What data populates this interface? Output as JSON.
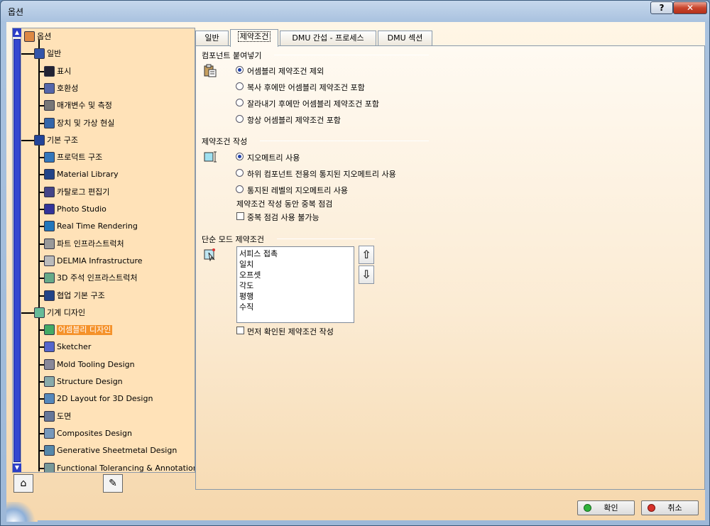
{
  "window": {
    "title": "옵션",
    "help": "?",
    "close": "✕"
  },
  "tree": {
    "items": [
      {
        "label": "옵션",
        "icon": "options-root-icon"
      },
      {
        "label": "일반",
        "icon": "general-icon"
      },
      {
        "label": "표시",
        "icon": "display-icon"
      },
      {
        "label": "호환성",
        "icon": "compatibility-icon"
      },
      {
        "label": "매개변수 및 측정",
        "icon": "parameters-icon"
      },
      {
        "label": "장치 및 가상 현실",
        "icon": "devices-icon"
      },
      {
        "label": "기본 구조",
        "icon": "infrastructure-icon"
      },
      {
        "label": "프로덕트 구조",
        "icon": "product-structure-icon"
      },
      {
        "label": "Material Library",
        "icon": "material-library-icon"
      },
      {
        "label": "카탈로그 편집기",
        "icon": "catalog-editor-icon"
      },
      {
        "label": "Photo Studio",
        "icon": "photo-studio-icon"
      },
      {
        "label": "Real Time Rendering",
        "icon": "rendering-icon"
      },
      {
        "label": "파트 인프라스트럭처",
        "icon": "part-infra-icon"
      },
      {
        "label": "DELMIA Infrastructure",
        "icon": "delmia-icon"
      },
      {
        "label": "3D 주석 인프라스트럭처",
        "icon": "annotation-infra-icon"
      },
      {
        "label": "협업 기본 구조",
        "icon": "collab-icon"
      },
      {
        "label": "기계 디자인",
        "icon": "mechanical-design-icon"
      },
      {
        "label": "어셈블리 디자인",
        "icon": "assembly-design-icon"
      },
      {
        "label": "Sketcher",
        "icon": "sketcher-icon"
      },
      {
        "label": "Mold Tooling Design",
        "icon": "mold-icon"
      },
      {
        "label": "Structure Design",
        "icon": "structure-icon"
      },
      {
        "label": "2D Layout for 3D Design",
        "icon": "layout-icon"
      },
      {
        "label": "도면",
        "icon": "drawing-icon"
      },
      {
        "label": "Composites Design",
        "icon": "composites-icon"
      },
      {
        "label": "Generative Sheetmetal Design",
        "icon": "sheetmetal-icon"
      },
      {
        "label": "Functional Tolerancing & Annotation",
        "icon": "tolerancing-icon"
      }
    ]
  },
  "tabs": [
    {
      "label": "일반"
    },
    {
      "label": "제약조건"
    },
    {
      "label": "DMU 간섭 - 프로세스"
    },
    {
      "label": "DMU 섹션"
    }
  ],
  "paste": {
    "title": "컴포넌트 붙여넣기",
    "options": [
      "어셈블리 제약조건 제외",
      "복사 후에만 어셈블리 제약조건 포함",
      "잘라내기 후에만 어셈블리 제약조건 포함",
      "항상 어셈블리 제약조건 포함"
    ],
    "selected": 0
  },
  "create": {
    "title": "제약조건 작성",
    "options": [
      "지오메트리 사용",
      "하위 컴포넌트 전용의 통지된 지오메트리 사용",
      "통지된 레벨의 지오메트리 사용"
    ],
    "selected": 0,
    "dup_label": "제약조건 작성 동안 중복 점검",
    "dup_checkbox": "중복 점검 사용 불가능"
  },
  "quick": {
    "title": "단순 모드 제약조건",
    "list": [
      "서피스 접촉",
      "일치",
      "오프셋",
      "각도",
      "평행",
      "수직"
    ],
    "up": "⇧",
    "down": "⇩",
    "checkbox": "먼저 확인된 제약조건 작성"
  },
  "buttons": {
    "ok": "확인",
    "cancel": "취소"
  },
  "colors": {
    "ok": "#2fb33b",
    "cancel": "#d7322a",
    "selected": "#f5922a"
  }
}
